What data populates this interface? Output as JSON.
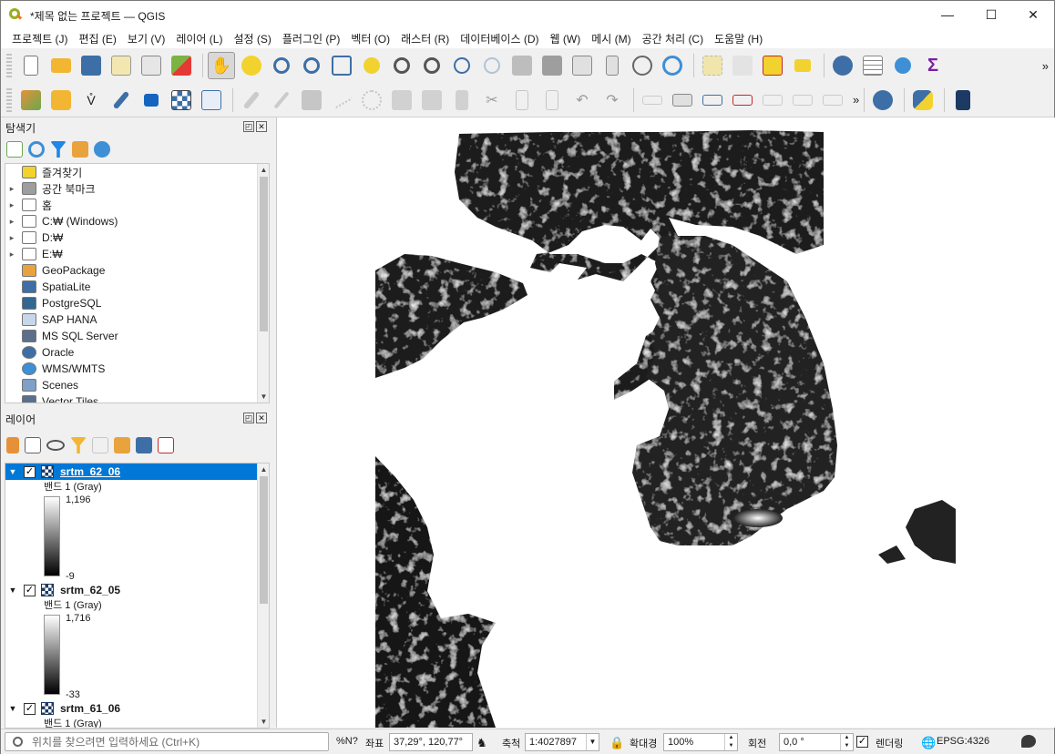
{
  "window": {
    "title": "*제목 없는 프로젝트 — QGIS",
    "minimize": "—",
    "maximize": "☐",
    "close": "✕"
  },
  "menu": [
    "프로젝트 (J)",
    "편집 (E)",
    "보기 (V)",
    "레이어 (L)",
    "설정 (S)",
    "플러그인 (P)",
    "벡터 (O)",
    "래스터 (R)",
    "데이터베이스 (D)",
    "웹 (W)",
    "메시 (M)",
    "공간 처리 (C)",
    "도움말 (H)"
  ],
  "toolbar_overflow": "»",
  "browser": {
    "title": "탐색기",
    "items": [
      {
        "label": "즐겨찾기",
        "icon": "star-icon",
        "expand": ""
      },
      {
        "label": "공간 북마크",
        "icon": "bookmark-icon",
        "expand": "▸"
      },
      {
        "label": "홈",
        "icon": "home-folder-icon",
        "expand": "▸"
      },
      {
        "label": "C:₩ (Windows)",
        "icon": "folder-icon",
        "expand": "▸"
      },
      {
        "label": "D:₩",
        "icon": "folder-icon",
        "expand": "▸"
      },
      {
        "label": "E:₩",
        "icon": "folder-icon",
        "expand": "▸"
      },
      {
        "label": "GeoPackage",
        "icon": "geopackage-icon",
        "expand": ""
      },
      {
        "label": "SpatiaLite",
        "icon": "spatialite-icon",
        "expand": ""
      },
      {
        "label": "PostgreSQL",
        "icon": "postgresql-icon",
        "expand": ""
      },
      {
        "label": "SAP HANA",
        "icon": "sap-hana-icon",
        "expand": ""
      },
      {
        "label": "MS SQL Server",
        "icon": "mssql-icon",
        "expand": ""
      },
      {
        "label": "Oracle",
        "icon": "oracle-icon",
        "expand": ""
      },
      {
        "label": "WMS/WMTS",
        "icon": "wms-globe-icon",
        "expand": ""
      },
      {
        "label": "Scenes",
        "icon": "scenes-icon",
        "expand": ""
      },
      {
        "label": "Vector Tiles",
        "icon": "vector-tiles-icon",
        "expand": ""
      }
    ]
  },
  "layers": {
    "title": "레이어",
    "items": [
      {
        "name": "srtm_62_06",
        "band": "밴드 1 (Gray)",
        "max": "1,196",
        "min": "-9",
        "checked": "✓",
        "selected": true
      },
      {
        "name": "srtm_62_05",
        "band": "밴드 1 (Gray)",
        "max": "1,716",
        "min": "-33",
        "checked": "✓",
        "selected": false
      },
      {
        "name": "srtm_61_06",
        "band": "밴드 1 (Gray)",
        "checked": "✓",
        "selected": false
      }
    ]
  },
  "status": {
    "locator_placeholder": "위치를 찾으려면 입력하세요 (Ctrl+K)",
    "toggle_label": "%N?",
    "coord_label": "좌표",
    "coord_value": "37,29°, 120,77°",
    "scale_label": "축척",
    "scale_value": "1:4027897",
    "magnifier_label": "확대경",
    "magnifier_value": "100%",
    "rotation_label": "회전",
    "rotation_value": "0,0 °",
    "render_label": "렌더링",
    "render_checked": "✓",
    "crs": "EPSG:4326"
  },
  "colors": {
    "selection": "#0078d7",
    "accent_green": "#6aa84f",
    "map_bg": "#ffffff"
  }
}
